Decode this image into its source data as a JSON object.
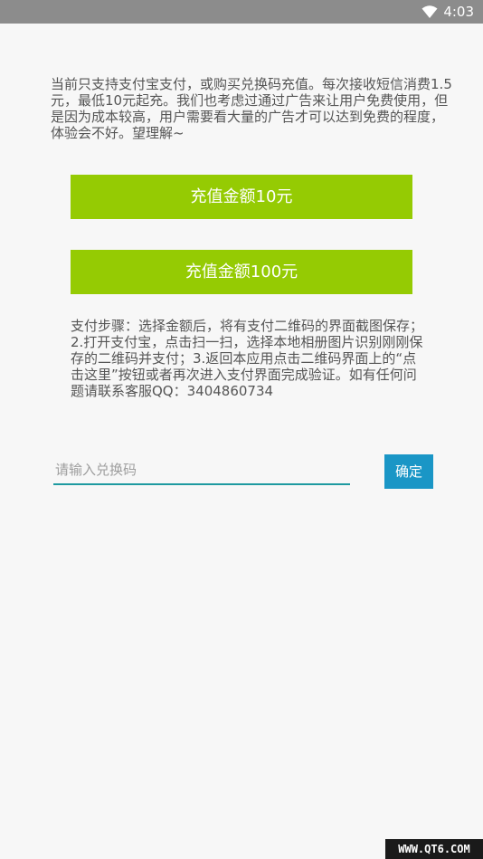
{
  "status_bar": {
    "time": "4:03",
    "icon": "wifi-icon"
  },
  "notice": {
    "text": "当前只支持支付宝支付，或购买兑换码充值。每次接收短信消费1.5元，最低10元起充。我们也考虑过通过广告来让用户免费使用，但是因为成本较高，用户需要看大量的广告才可以达到免费的程度，体验会不好。望理解~"
  },
  "recharge_buttons": [
    {
      "label": "充值金额10元"
    },
    {
      "label": "充值金额100元"
    }
  ],
  "payment_steps": {
    "text": "支付步骤：选择金额后，将有支付二维码的界面截图保存；2.打开支付宝，点击扫一扫，选择本地相册图片识别刚刚保存的二维码并支付；3.返回本应用点击二维码界面上的“点击这里”按钮或者再次进入支付界面完成验证。如有任何问题请联系客服QQ：3404860734"
  },
  "redeem": {
    "placeholder": "请输入兑换码",
    "value": "",
    "confirm_label": "确定"
  },
  "watermark": {
    "text": "WWW.QT6.COM"
  },
  "colors": {
    "recharge_button": "#95cb03",
    "confirm_button": "#1a96c6",
    "input_underline": "#1e9aa0",
    "status_bar": "#8c8c8c"
  }
}
